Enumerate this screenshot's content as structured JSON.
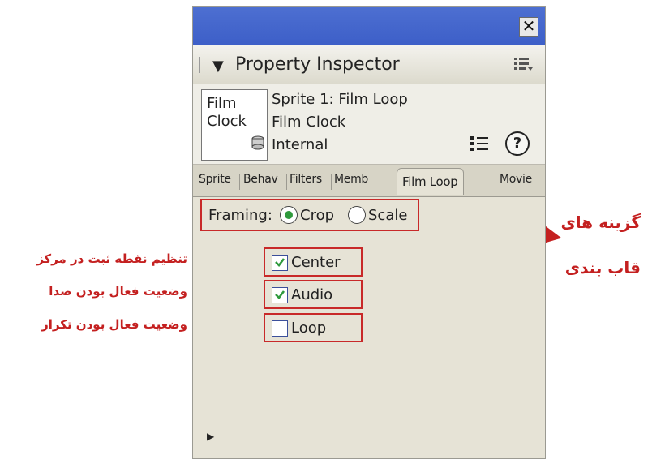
{
  "panel": {
    "close_glyph": "✕",
    "title": "Property Inspector",
    "collapse_icon": "triangle-down-icon",
    "options_icon": "list-options-icon"
  },
  "info": {
    "thumb_line1": "Film",
    "thumb_line2": "Clock",
    "sprite": "Sprite 1: Film Loop",
    "member": "Film Clock",
    "cast": "Internal",
    "list_icon": "list-view-icon",
    "help_glyph": "?"
  },
  "tabs": [
    {
      "label": "Sprite",
      "active": false
    },
    {
      "label": "Behav",
      "active": false
    },
    {
      "label": "Filters",
      "active": false
    },
    {
      "label": "Memb",
      "active": false
    },
    {
      "label": "Film Loop",
      "active": true
    },
    {
      "label": "Movie",
      "active": false
    }
  ],
  "framing": {
    "label": "Framing:",
    "options": [
      {
        "label": "Crop",
        "selected": true
      },
      {
        "label": "Scale",
        "selected": false
      }
    ]
  },
  "checkboxes": [
    {
      "label": "Center",
      "checked": true
    },
    {
      "label": "Audio",
      "checked": true
    },
    {
      "label": "Loop",
      "checked": false
    }
  ],
  "annotations": {
    "center": "تنظیم نقطه ثبت در مرکز",
    "audio": "وضعیت فعال بودن صدا",
    "loop": "وضعیت فعال بودن تکرار",
    "framing_line1": "گزینه های",
    "framing_line2": "قاب بندی"
  },
  "colors": {
    "annotation": "#c42020",
    "titlebar": "#4467cf",
    "panel": "#e6e3d6",
    "check": "#2f9a3c"
  }
}
